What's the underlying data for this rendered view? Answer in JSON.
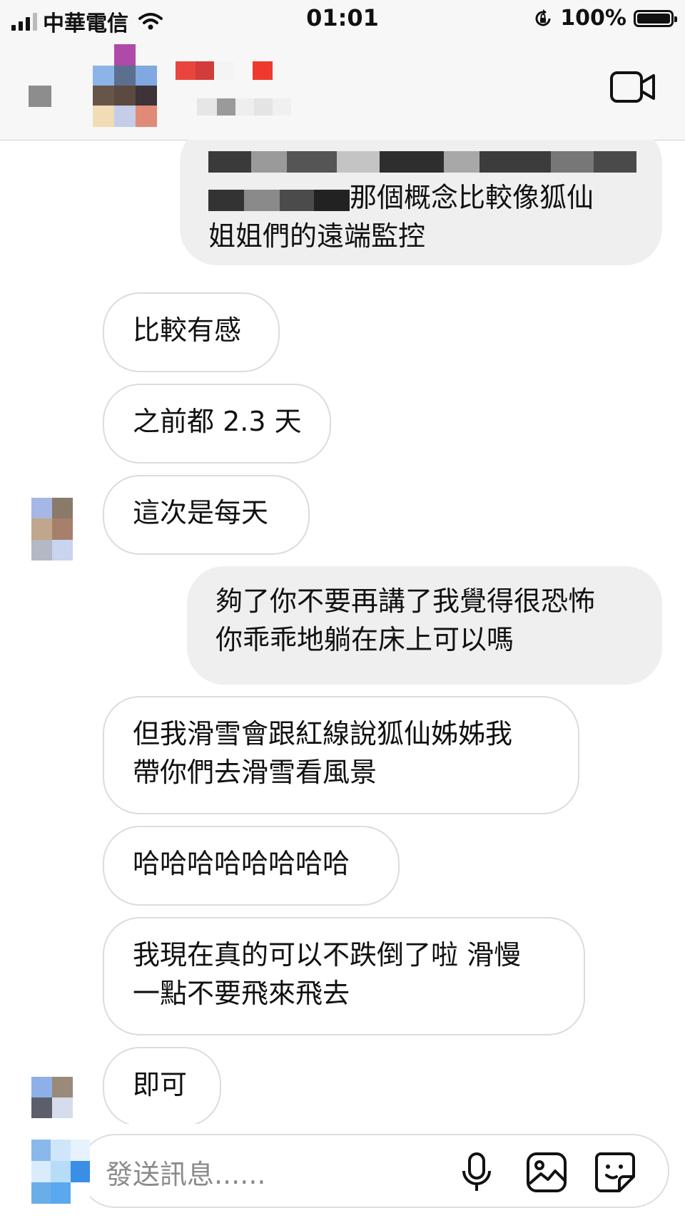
{
  "status_bar": {
    "carrier": "中華電信",
    "time": "01:01",
    "battery_percent": "100%",
    "battery_level": 1.0,
    "signal_bars": 3,
    "icons": [
      "signal-icon",
      "wifi-icon",
      "orientation-lock-icon",
      "battery-icon"
    ]
  },
  "header": {
    "icons": [
      "back-chevron-icon",
      "video-call-icon"
    ]
  },
  "messages": [
    {
      "side": "outgoing",
      "lines": [
        "",
        "那個概念比較像狐仙",
        "姐姐們的遠端監控"
      ]
    },
    {
      "side": "incoming",
      "lines": [
        "比較有感"
      ]
    },
    {
      "side": "incoming",
      "lines": [
        "之前都 2.3 天"
      ]
    },
    {
      "side": "incoming",
      "lines": [
        "這次是每天"
      ]
    },
    {
      "side": "outgoing",
      "lines": [
        "夠了你不要再講了我覺得很恐怖",
        "你乖乖地躺在床上可以嗎"
      ]
    },
    {
      "side": "incoming",
      "lines": [
        "但我滑雪會跟紅線說狐仙姊姊我",
        "帶你們去滑雪看風景"
      ]
    },
    {
      "side": "incoming",
      "lines": [
        "哈哈哈哈哈哈哈哈"
      ]
    },
    {
      "side": "incoming",
      "lines": [
        "我現在真的可以不跌倒了啦 滑慢",
        "一點不要飛來飛去"
      ]
    },
    {
      "side": "incoming",
      "lines": [
        "即可"
      ]
    }
  ],
  "composer": {
    "placeholder": "發送訊息......",
    "icons": [
      "microphone-icon",
      "gallery-icon",
      "sticker-icon"
    ]
  },
  "colors": {
    "incoming_bubble_border": "#dcdcdc",
    "outgoing_bubble_bg": "#efefef",
    "header_bg": "#f7f7f7"
  }
}
